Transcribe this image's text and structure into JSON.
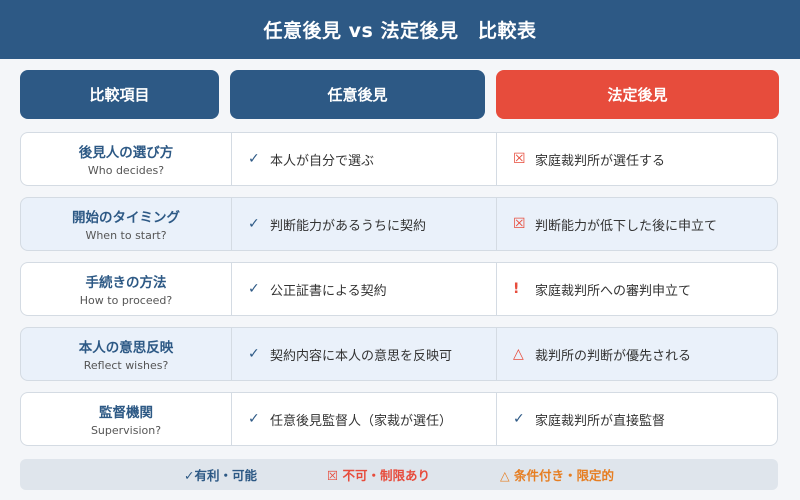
{
  "title": "任意後見 vs 法定後見　比較表",
  "headers": [
    "比較項目",
    "任意後見",
    "法定後見"
  ],
  "rows": [
    {
      "label": "後見人の選び方",
      "sub": "Who decides?",
      "voluntary": {
        "mark": "✓",
        "type": "check",
        "text": "本人が自分で選ぶ"
      },
      "statutory": {
        "mark": "☒",
        "type": "cross",
        "text": "家庭裁判所が選任する"
      }
    },
    {
      "label": "開始のタイミング",
      "sub": "When to start?",
      "voluntary": {
        "mark": "✓",
        "type": "check",
        "text": "判断能力があるうちに契約"
      },
      "statutory": {
        "mark": "☒",
        "type": "cross",
        "text": "判断能力が低下した後に申立て"
      }
    },
    {
      "label": "手続きの方法",
      "sub": "How to proceed?",
      "voluntary": {
        "mark": "✓",
        "type": "check",
        "text": "公正証書による契約"
      },
      "statutory": {
        "mark": "!",
        "type": "bang",
        "text": "家庭裁判所への審判申立て"
      }
    },
    {
      "label": "本人の意思反映",
      "sub": "Reflect wishes?",
      "voluntary": {
        "mark": "✓",
        "type": "check",
        "text": "契約内容に本人の意思を反映可"
      },
      "statutory": {
        "mark": "△",
        "type": "tri",
        "text": "裁判所の判断が優先される"
      }
    },
    {
      "label": "監督機関",
      "sub": "Supervision?",
      "voluntary": {
        "mark": "✓",
        "type": "check",
        "text": "任意後見監督人（家裁が選任）"
      },
      "statutory": {
        "mark": "✓",
        "type": "check",
        "text": "家庭裁判所が直接監督"
      }
    }
  ],
  "legend": {
    "ok": "✓有利・可能",
    "ng": "☒ 不可・制限あり",
    "cond": "△ 条件付き・限定的"
  },
  "colors": {
    "primary": "#2d5985",
    "accent": "#e74c3c",
    "conditional": "#e67e22"
  }
}
